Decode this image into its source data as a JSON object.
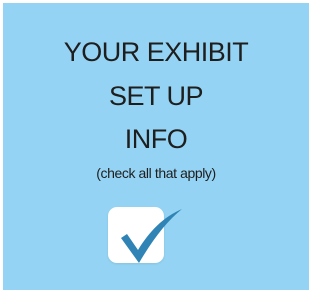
{
  "card": {
    "title_lines": [
      "YOUR EXHIBIT",
      "SET UP",
      "INFO"
    ],
    "subtitle": "(check all that apply)",
    "checkbox": {
      "checked": true,
      "check_icon": "checkmark-icon",
      "check_color": "#2f84b5",
      "box_color": "#ffffff"
    }
  },
  "colors": {
    "background": "#94d3f3",
    "text": "#1e1e1e"
  }
}
